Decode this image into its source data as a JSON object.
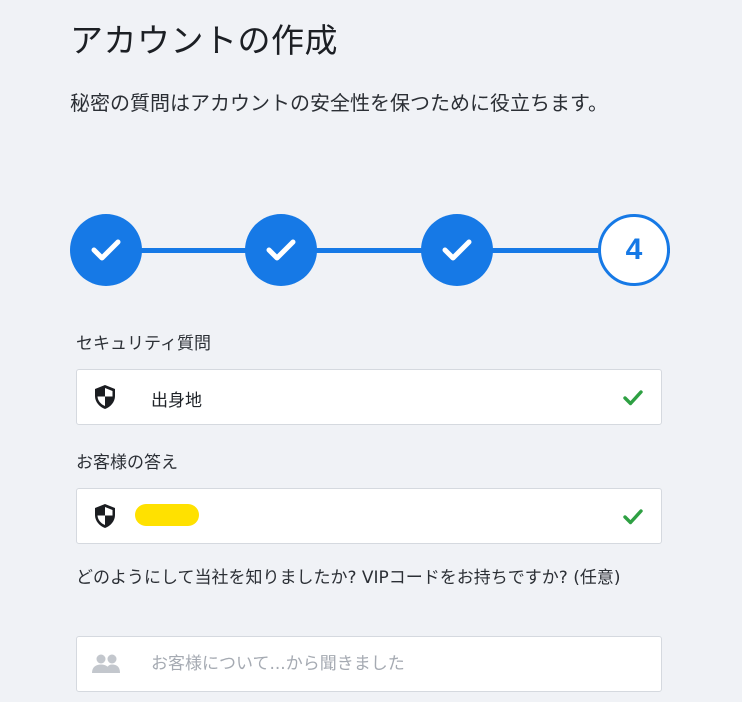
{
  "page": {
    "title": "アカウントの作成",
    "subtitle": "秘密の質問はアカウントの安全性を保つために役立ちます。"
  },
  "stepper": {
    "steps": [
      {
        "state": "completed",
        "icon": "check-icon"
      },
      {
        "state": "completed",
        "icon": "check-icon"
      },
      {
        "state": "completed",
        "icon": "check-icon"
      },
      {
        "state": "current",
        "label": "4"
      }
    ],
    "accent_color": "#1679e6"
  },
  "security_question": {
    "label": "セキュリティ質問",
    "value": "出身地",
    "icon": "shield-icon",
    "status_icon": "check-icon",
    "status_color": "#2ea043"
  },
  "answer": {
    "label": "お客様の答え",
    "icon": "shield-icon",
    "status_icon": "check-icon",
    "redaction_color": "#ffe100"
  },
  "referral": {
    "label": "どのようにして当社を知りましたか? VIPコードをお持ちですか? (任意)",
    "placeholder": "お客様について...から聞きました",
    "icon": "people-icon"
  }
}
